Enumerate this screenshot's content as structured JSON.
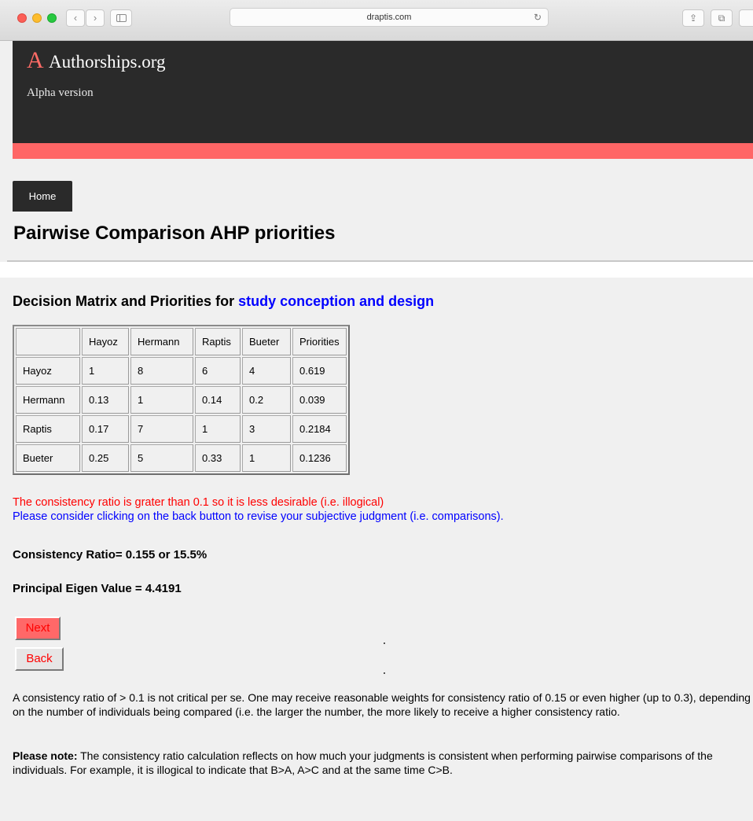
{
  "browser": {
    "url": "draptis.com",
    "back_glyph": "‹",
    "forward_glyph": "›",
    "reload_glyph": "↻",
    "share_glyph": "⇪",
    "tabs_glyph": "⧉"
  },
  "site": {
    "logo_letter": "A",
    "name": "Authorships.org",
    "tagline": "Alpha version",
    "accent_color": "#ff6666"
  },
  "nav": {
    "home_label": "Home"
  },
  "page_title": "Pairwise Comparison AHP priorities",
  "section": {
    "title_prefix": "Decision Matrix and Priorities for",
    "topic": "study conception and design"
  },
  "matrix": {
    "headers": [
      "",
      "Hayoz",
      "Hermann",
      "Raptis",
      "Bueter",
      "Priorities"
    ],
    "rows": [
      [
        "Hayoz",
        "1",
        "8",
        "6",
        "4",
        "0.619"
      ],
      [
        "Hermann",
        "0.13",
        "1",
        "0.14",
        "0.2",
        "0.039"
      ],
      [
        "Raptis",
        "0.17",
        "7",
        "1",
        "3",
        "0.2184"
      ],
      [
        "Bueter",
        "0.25",
        "5",
        "0.33",
        "1",
        "0.1236"
      ]
    ]
  },
  "messages": {
    "warning": "The consistency ratio is grater than 0.1 so it is less desirable (i.e. illogical)",
    "advice": "Please consider clicking on the back button to revise your subjective judgment (i.e. comparisons)."
  },
  "stats": {
    "consistency_ratio": "Consistency Ratio= 0.155 or 15.5%",
    "eigen_value": "Principal Eigen Value = 4.4191"
  },
  "buttons": {
    "next": "Next",
    "back": "Back"
  },
  "notes": {
    "p1": "A consistency ratio of > 0.1 is not critical per se. One may receive reasonable weights for consistency ratio of 0.15 or even higher (up to 0.3), depending on the number of individuals being compared (i.e. the larger the number, the more likely to receive a higher consistency ratio.",
    "p2_label": "Please note:",
    "p2": " The consistency ratio calculation reflects on how much your judgments is consistent when performing pairwise comparisons of the individuals. For example, it is illogical to indicate that B>A, A>C and at the same time C>B."
  }
}
